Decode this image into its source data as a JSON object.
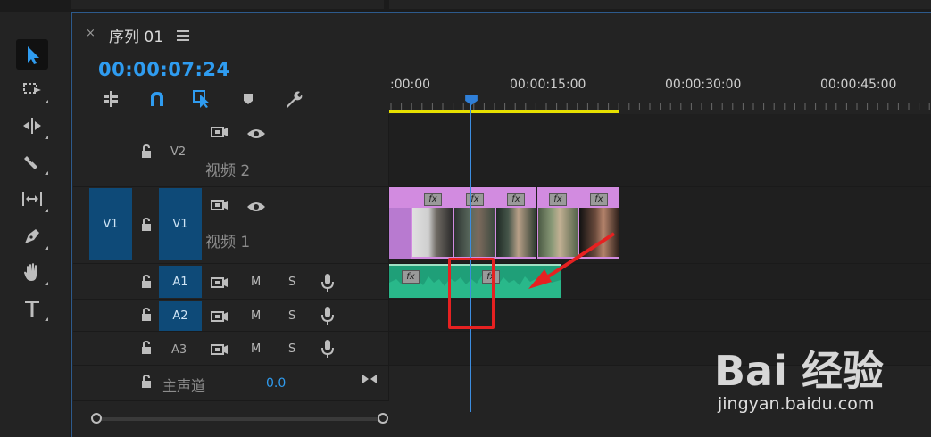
{
  "sequence": {
    "tab_title": "序列 01",
    "close_symbol": "×",
    "timecode": "00:00:07:24"
  },
  "ruler": {
    "labels": [
      ":00:00",
      "00:00:15:00",
      "00:00:30:00",
      "00:00:45:00"
    ]
  },
  "tracks": {
    "v2": {
      "label": "V2",
      "name": "视频 2"
    },
    "v1": {
      "source": "V1",
      "label": "V1",
      "name": "视频 1"
    },
    "a1": {
      "label": "A1",
      "mute": "M",
      "solo": "S"
    },
    "a2": {
      "label": "A2",
      "mute": "M",
      "solo": "S"
    },
    "a3": {
      "label": "A3",
      "mute": "M",
      "solo": "S"
    },
    "master": {
      "label": "主声道",
      "value": "0.0"
    }
  },
  "clips": {
    "fx_label": "fx"
  },
  "colors": {
    "accent": "#2f9cf0",
    "track_badge": "#0e4a78",
    "video_clip": "#d28be0",
    "audio_clip": "#1f9f78",
    "work_area": "#e6e000",
    "annotation": "#e62121"
  },
  "watermark": {
    "logo": "Bai 经验",
    "url": "jingyan.baidu.com"
  }
}
